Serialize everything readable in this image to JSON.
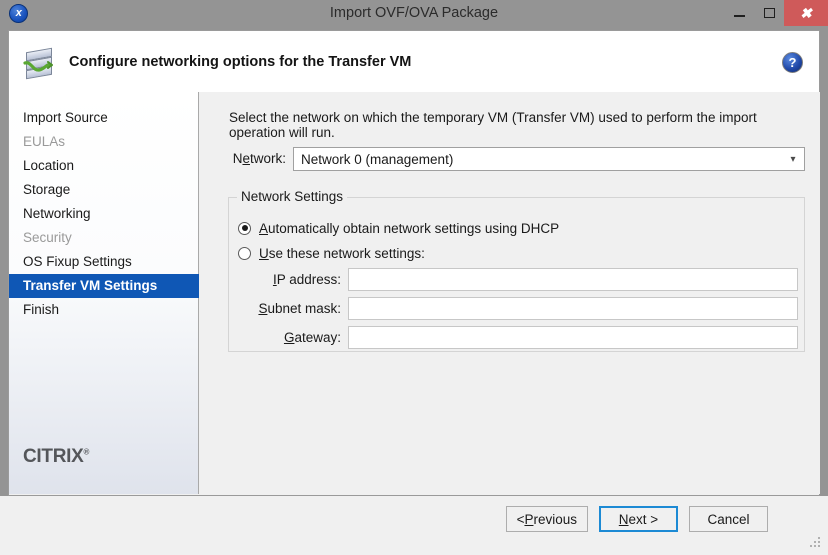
{
  "window": {
    "title": "Import OVF/OVA Package",
    "app_icon": "xencenter-logo-icon",
    "controls": {
      "minimize": "minimize-icon",
      "maximize": "maximize-icon",
      "close": "close-icon"
    },
    "close_color": "#cf5a5a",
    "titlebar_color": "#949494"
  },
  "header": {
    "title": "Configure networking options for the Transfer VM",
    "icon": "transfer-vm-network-icon",
    "help_label": "?",
    "help_color": "#1f48a8"
  },
  "sidebar": {
    "items": [
      {
        "label": "Import Source",
        "state": "enabled"
      },
      {
        "label": "EULAs",
        "state": "disabled"
      },
      {
        "label": "Location",
        "state": "enabled"
      },
      {
        "label": "Storage",
        "state": "enabled"
      },
      {
        "label": "Networking",
        "state": "enabled"
      },
      {
        "label": "Security",
        "state": "disabled"
      },
      {
        "label": "OS Fixup Settings",
        "state": "enabled"
      },
      {
        "label": "Transfer VM Settings",
        "state": "selected"
      },
      {
        "label": "Finish",
        "state": "enabled"
      }
    ],
    "selected_index": 7,
    "selection_color": "#0f57b5",
    "brand": "CITRIX",
    "brand_mark": "®"
  },
  "content": {
    "intro": "Select the network on which the temporary VM (Transfer VM) used to perform the import operation will run.",
    "network": {
      "label": "Network:",
      "label_mnemonic": "e",
      "selected_value": "Network 0 (management)",
      "options": [
        "Network 0 (management)"
      ],
      "arrow_icon": "chevron-down-icon"
    },
    "group": {
      "legend": "Network Settings",
      "radios": [
        {
          "label": "Automatically obtain network settings using DHCP",
          "mnemonic": "A",
          "checked": true
        },
        {
          "label": "Use these network settings:",
          "mnemonic": "U",
          "checked": false
        }
      ],
      "fields": [
        {
          "label": "IP address:",
          "mnemonic": "I",
          "value": "",
          "placeholder": ""
        },
        {
          "label": "Subnet mask:",
          "mnemonic": "S",
          "value": "",
          "placeholder": ""
        },
        {
          "label": "Gateway:",
          "mnemonic": "G",
          "value": "",
          "placeholder": ""
        }
      ]
    }
  },
  "footer": {
    "buttons": [
      {
        "label": "< Previous",
        "mnemonic": "P",
        "default": false
      },
      {
        "label": "Next >",
        "mnemonic": "N",
        "default": true
      },
      {
        "label": "Cancel",
        "mnemonic": "",
        "default": false
      }
    ],
    "resize_grip": "resize-grip-icon"
  }
}
